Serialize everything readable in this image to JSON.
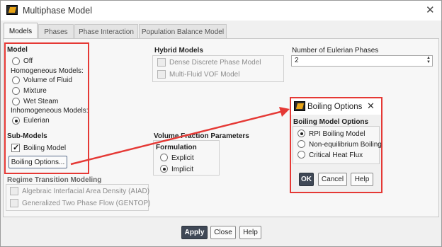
{
  "window": {
    "title": "Multiphase Model",
    "close_glyph": "✕"
  },
  "tabs": [
    {
      "label": "Models",
      "active": true
    },
    {
      "label": "Phases",
      "active": false
    },
    {
      "label": "Phase Interaction",
      "active": false
    },
    {
      "label": "Population Balance Model",
      "active": false
    }
  ],
  "model": {
    "title": "Model",
    "off": "Off",
    "homogeneous_label": "Homogeneous Models:",
    "vof": "Volume of Fluid",
    "mixture": "Mixture",
    "wet_steam": "Wet Steam",
    "inhomogeneous_label": "Inhomogeneous Models:",
    "eulerian": "Eulerian",
    "selected": "Eulerian"
  },
  "submodels": {
    "title": "Sub-Models",
    "boiling_model": "Boiling Model",
    "boiling_model_checked": true,
    "boiling_options_button": "Boiling Options..."
  },
  "hybrid": {
    "title": "Hybrid Models",
    "ddpm": "Dense Discrete Phase Model",
    "mfvof": "Multi-Fluid VOF Model"
  },
  "eulerian_phases": {
    "label": "Number of Eulerian Phases",
    "value": "2"
  },
  "volume_fraction": {
    "title": "Volume Fraction Parameters",
    "formulation_title": "Formulation",
    "explicit": "Explicit",
    "implicit": "Implicit",
    "selected": "Implicit"
  },
  "regime": {
    "title": "Regime Transition Modeling",
    "aiad": "Algebraic Interfacial Area Density (AIAD)",
    "gentop": "Generalized Two Phase Flow (GENTOP)"
  },
  "footer": {
    "apply": "Apply",
    "close": "Close",
    "help": "Help"
  },
  "boiling_dialog": {
    "title": "Boiling Options",
    "close_glyph": "✕",
    "group_title": "Boiling Model Options",
    "rpi": "RPI Boiling Model",
    "non_eq": "Non-equilibrium Boiling",
    "chf": "Critical Heat Flux",
    "selected": "RPI Boiling Model",
    "ok": "OK",
    "cancel": "Cancel",
    "help": "Help"
  },
  "colors": {
    "highlight": "#e53935",
    "primary_button": "#3f4856"
  }
}
